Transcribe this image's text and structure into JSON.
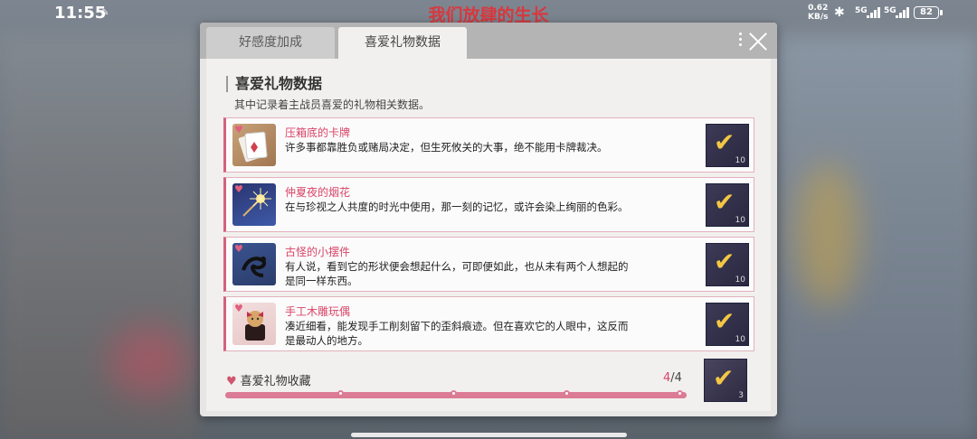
{
  "status_bar": {
    "time": "11:55",
    "net_speed_value": "0.62",
    "net_speed_unit": "KB/s",
    "signal_1": "5G",
    "signal_2": "5G",
    "battery": "82"
  },
  "app_title": "我们放肆的生长",
  "dialog": {
    "tabs": [
      {
        "label": "好感度加成",
        "active": false
      },
      {
        "label": "喜爱礼物数据",
        "active": true
      }
    ],
    "section_title": "喜爱礼物数据",
    "section_desc": "其中记录着主战员喜爱的礼物相关数据。",
    "gifts": [
      {
        "name": "压箱底的卡牌",
        "desc": "许多事都靠胜负或赌局决定，但生死攸关的大事，绝不能用卡牌裁决。",
        "icon": "cards-icon",
        "reward_count": "10"
      },
      {
        "name": "仲夏夜的烟花",
        "desc": "在与珍视之人共度的时光中使用，那一刻的记忆，或许会染上绚丽的色彩。",
        "icon": "sparkler-icon",
        "reward_count": "10"
      },
      {
        "name": "古怪的小摆件",
        "desc": "有人说，看到它的形状便会想起什么，可即便如此，也从未有两个人想起的是同一样东西。",
        "icon": "ornament-icon",
        "reward_count": "10"
      },
      {
        "name": "手工木雕玩偶",
        "desc": "凑近细看，能发现手工削刻留下的歪斜痕迹。但在喜欢它的人眼中，这反而是最动人的地方。",
        "icon": "wooden-doll-icon",
        "reward_count": "10"
      }
    ],
    "collection": {
      "label": "喜爱礼物收藏",
      "current": "4",
      "total": "/4",
      "progress_fraction": 1.0,
      "milestones": 4,
      "reward_count": "3"
    }
  },
  "colors": {
    "accent_pink": "#d94467",
    "title_red": "#d8383f",
    "check_gold": "#f3c743"
  }
}
